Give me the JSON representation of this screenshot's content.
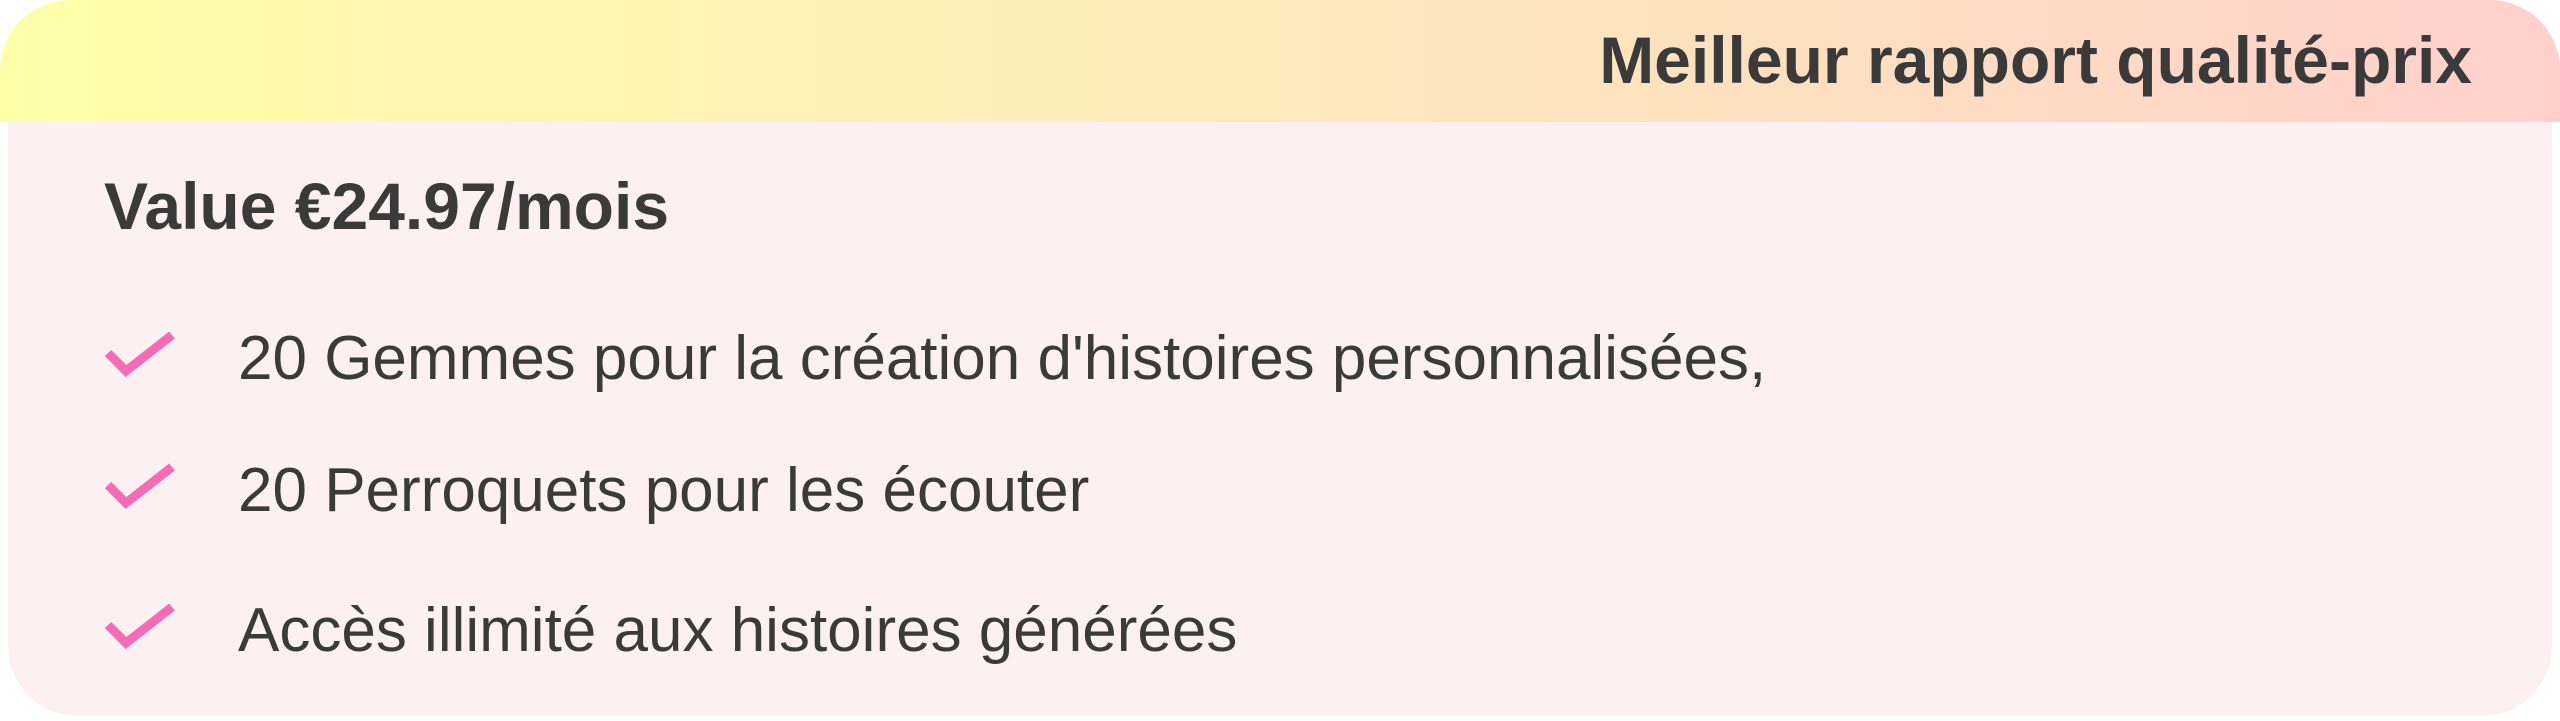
{
  "badge": {
    "label": "Meilleur rapport qualité-prix"
  },
  "plan": {
    "price_label": "Value €24.97/mois"
  },
  "features": [
    {
      "icon": "check-icon",
      "text": "20 Gemmes pour la création d'histoires personnalisées,"
    },
    {
      "icon": "check-icon",
      "text": "20 Perroquets pour les écouter"
    },
    {
      "icon": "check-icon",
      "text": "Accès illimité aux histoires générées"
    }
  ],
  "colors": {
    "accent": "#f56bb5",
    "card_bg": "#fcf0f2",
    "gradient_start": "#ffffa8",
    "gradient_end": "#ffd0cc",
    "text": "#3a3a3a"
  }
}
